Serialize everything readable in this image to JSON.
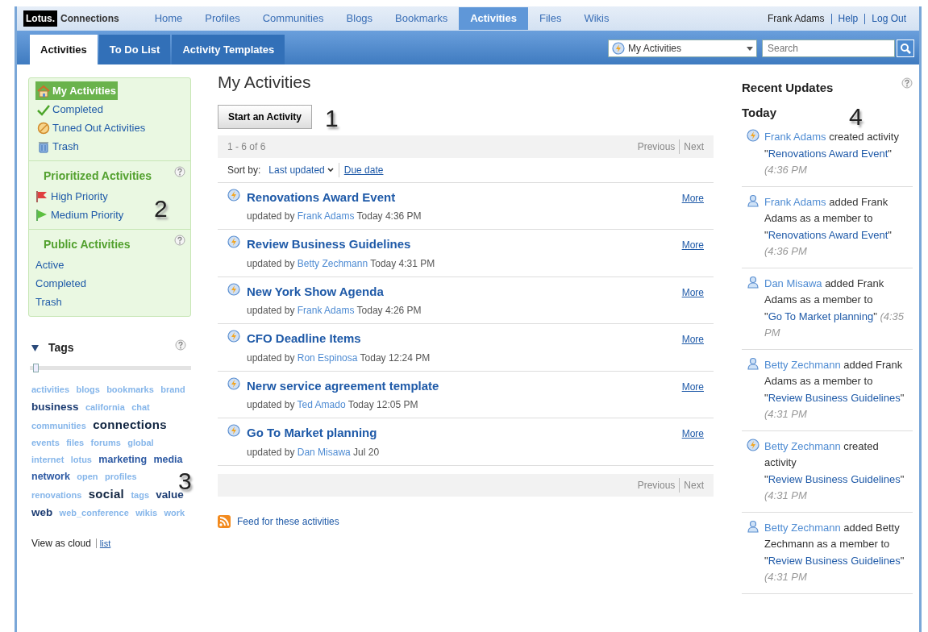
{
  "logo": {
    "brand": "Lotus.",
    "product": "Connections"
  },
  "nav": [
    {
      "label": "Home",
      "selected": false
    },
    {
      "label": "Profiles",
      "selected": false
    },
    {
      "label": "Communities",
      "selected": false
    },
    {
      "label": "Blogs",
      "selected": false
    },
    {
      "label": "Bookmarks",
      "selected": false
    },
    {
      "label": "Activities",
      "selected": true
    },
    {
      "label": "Files",
      "selected": false
    },
    {
      "label": "Wikis",
      "selected": false
    }
  ],
  "user_links": [
    {
      "label": "Frank Adams",
      "kind": "text"
    },
    {
      "label": "Help",
      "kind": "link"
    },
    {
      "label": "Log Out",
      "kind": "link"
    }
  ],
  "tabs": [
    {
      "label": "Activities",
      "selected": true
    },
    {
      "label": "To Do List",
      "selected": false
    },
    {
      "label": "Activity Templates",
      "selected": false
    }
  ],
  "scope": {
    "value": "My Activities"
  },
  "search": {
    "placeholder": "Search"
  },
  "sidebar": {
    "sections": [
      {
        "items": [
          {
            "label": "My Activities",
            "kind": "home",
            "selected": true
          },
          {
            "label": "Completed",
            "kind": "done",
            "selected": false
          },
          {
            "label": "Tuned Out Activities",
            "kind": "tunedout",
            "selected": false
          },
          {
            "label": "Trash",
            "kind": "trash",
            "selected": false
          }
        ]
      },
      {
        "title": "Prioritized Activities",
        "items": [
          {
            "label": "High Priority",
            "kind": "high",
            "selected": false
          },
          {
            "label": "Medium Priority",
            "kind": "medium",
            "selected": false
          }
        ]
      },
      {
        "title": "Public Activities",
        "items": [
          {
            "label": "Active",
            "selected": false
          },
          {
            "label": "Completed",
            "selected": false
          },
          {
            "label": "Trash",
            "selected": false
          }
        ]
      }
    ]
  },
  "tags": {
    "title": "Tags",
    "expanded": true,
    "level": 0.02,
    "items": [
      {
        "text": "activities",
        "kind": "small"
      },
      {
        "text": "blogs",
        "kind": "small"
      },
      {
        "text": "bookmarks",
        "kind": "small"
      },
      {
        "text": "brand",
        "kind": "small"
      },
      {
        "text": "business",
        "kind": "large"
      },
      {
        "text": "california",
        "kind": "small"
      },
      {
        "text": "chat",
        "kind": "small"
      },
      {
        "text": "communities",
        "kind": "small"
      },
      {
        "text": "connections",
        "kind": "huge"
      },
      {
        "text": "events",
        "kind": "small"
      },
      {
        "text": "files",
        "kind": "small"
      },
      {
        "text": "forums",
        "kind": "small"
      },
      {
        "text": "global",
        "kind": "small"
      },
      {
        "text": "internet",
        "kind": "small"
      },
      {
        "text": "lotus",
        "kind": "small"
      },
      {
        "text": "marketing",
        "kind": "medium"
      },
      {
        "text": "media",
        "kind": "medium"
      },
      {
        "text": "network",
        "kind": "medium"
      },
      {
        "text": "open",
        "kind": "small"
      },
      {
        "text": "profiles",
        "kind": "small"
      },
      {
        "text": "renovations",
        "kind": "small"
      },
      {
        "text": "social",
        "kind": "huge"
      },
      {
        "text": "tags",
        "kind": "small"
      },
      {
        "text": "value",
        "kind": "large"
      },
      {
        "text": "web",
        "kind": "large"
      },
      {
        "text": "web_conference",
        "kind": "small"
      },
      {
        "text": "wikis",
        "kind": "small"
      },
      {
        "text": "work",
        "kind": "small"
      }
    ],
    "view_label": "View as cloud",
    "view_link": "list"
  },
  "main": {
    "title": "My Activities",
    "start_button": "Start an Activity",
    "range": "1 - 6 of 6",
    "previous": "Previous",
    "next": "Next",
    "previous_bottom": "Previous",
    "next_bottom": "Next",
    "sort_label": "Sort by:",
    "sort_options": [
      {
        "label": "Last updated",
        "selected": true
      },
      {
        "label": "Due date",
        "selected": false
      }
    ],
    "activities": [
      {
        "title": "Renovations Award Event",
        "prefix": "updated by",
        "author": "Frank Adams",
        "time": "Today 4:36 PM",
        "more": "More"
      },
      {
        "title": "Review Business Guidelines",
        "prefix": "updated by",
        "author": "Betty Zechmann",
        "time": "Today 4:31 PM",
        "more": "More"
      },
      {
        "title": "New York Show Agenda",
        "prefix": "updated by",
        "author": "Frank Adams",
        "time": "Today 4:26 PM",
        "more": "More"
      },
      {
        "title": "CFO Deadline Items",
        "prefix": "updated by",
        "author": "Ron Espinosa",
        "time": "Today 12:24 PM",
        "more": "More"
      },
      {
        "title": "Nerw service agreement template",
        "prefix": "updated by",
        "author": "Ted Amado",
        "time": "Today 12:05 PM",
        "more": "More"
      },
      {
        "title": "Go To Market planning",
        "prefix": "updated by",
        "author": "Dan Misawa",
        "time": "Jul 20",
        "more": "More"
      }
    ],
    "feed": "Feed for these activities"
  },
  "updates": {
    "title": "Recent Updates",
    "day": "Today",
    "items": [
      {
        "kind": "activity",
        "actor": "Frank Adams",
        "action": " created activity \"",
        "target": "Renovations Award Event",
        "close": "\" ",
        "time": "(4:36 PM"
      },
      {
        "kind": "member",
        "actor": "Frank Adams",
        "action": " added Frank Adams as a member to \"",
        "target": "Renovations Award Event",
        "close": "\" ",
        "time": "(4:36 PM"
      },
      {
        "kind": "member",
        "actor": "Dan Misawa",
        "action": " added Frank Adams as a member to \"",
        "target": "Go To Market planning",
        "close": "\" ",
        "time": "(4:35 PM"
      },
      {
        "kind": "member",
        "actor": "Betty Zechmann",
        "action": " added Frank Adams as a member to \"",
        "target": "Review Business Guidelines",
        "close": "\" ",
        "time": "(4:31 PM"
      },
      {
        "kind": "activity",
        "actor": "Betty Zechmann",
        "action": " created activity \"",
        "target": "Review Business Guidelines",
        "close": "\" ",
        "time": "(4:31 PM"
      },
      {
        "kind": "member",
        "actor": "Betty Zechmann",
        "action": " added Betty Zechmann as a member to \"",
        "target": "Review Business Guidelines",
        "close": "\" ",
        "time": "(4:31 PM"
      }
    ]
  },
  "annotations": [
    "1",
    "2",
    "3",
    "4"
  ]
}
